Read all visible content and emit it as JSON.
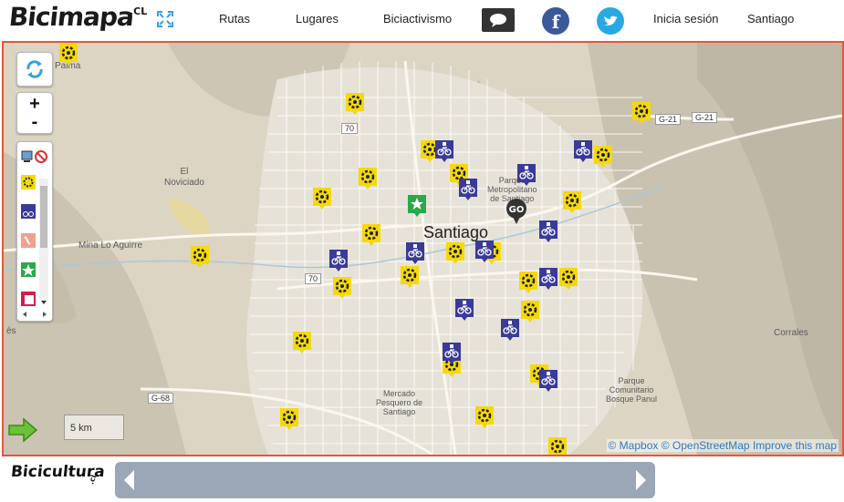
{
  "brand": {
    "logo": "Bicimapa",
    "logo_suffix": ".CL"
  },
  "nav": {
    "routes": "Rutas",
    "places": "Lugares",
    "activism": "Biciactivismo",
    "login": "Inicia sesión",
    "city": "Santiago"
  },
  "social": {
    "facebook": "f"
  },
  "map": {
    "city_label": "Santiago",
    "zoom_in": "+",
    "zoom_out": "-",
    "scale": "5 km",
    "attribution": {
      "mapbox": "© Mapbox",
      "osm": "© OpenStreetMap",
      "improve": "Improve this map"
    },
    "places": {
      "palma": "Palma",
      "el_noviciado": "El\nNoviciado",
      "mina": "Mina Lo Aguirre",
      "parque_metro": "Parque\nMetropolitano\nde Santiago",
      "mercado": "Mercado\nPesquero de\nSantiago",
      "parque_comunitario": "Parque\nComunitario\nBosque Panul",
      "corrales": "Corrales",
      "es": "és"
    },
    "roads": {
      "r70a": "70",
      "r70b": "70",
      "g21a": "G-21",
      "g21b": "G-21",
      "g68": "G-68"
    },
    "bubble_label": "GO",
    "layer_colors": {
      "repair": "#f5d90a",
      "parking": "#3a3a9a",
      "route": "#2aa84a",
      "accent": "#e8553a"
    }
  },
  "footer": {
    "biciculture": "Bicicultura",
    "biciculture_suffix": ".cl"
  }
}
